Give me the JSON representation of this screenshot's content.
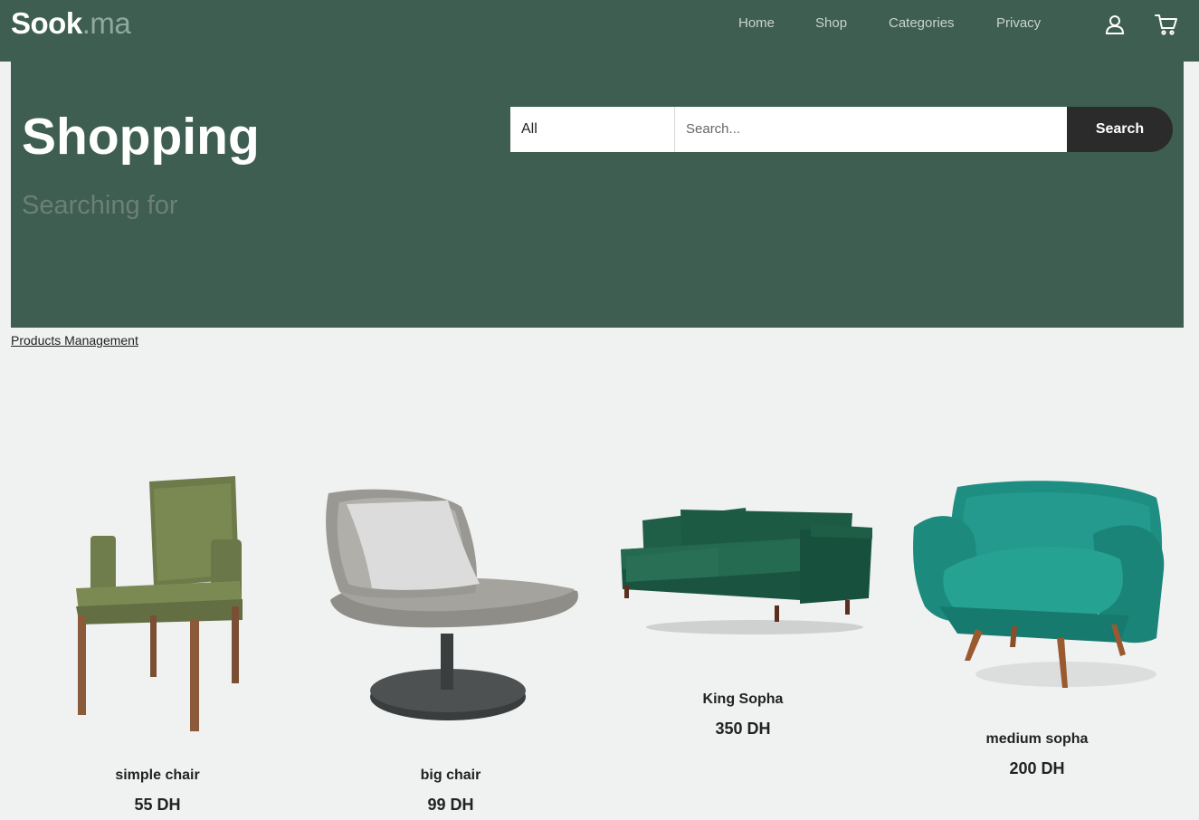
{
  "navbar": {
    "brand_main": "Sook",
    "brand_suffix": ".ma",
    "links": [
      "Home",
      "Shop",
      "Categories",
      "Privacy"
    ],
    "icons": [
      "user-icon",
      "cart-icon"
    ]
  },
  "hero": {
    "title": "Shopping",
    "subtitle": "Searching for"
  },
  "search": {
    "category": "All",
    "placeholder": "Search...",
    "button_label": "Search"
  },
  "management_link": "Products Management",
  "products": [
    {
      "name": "simple chair",
      "price": "55 DH"
    },
    {
      "name": "big chair",
      "price": "99 DH"
    },
    {
      "name": "King Sopha",
      "price": "350 DH"
    },
    {
      "name": "medium sopha",
      "price": "200 DH"
    }
  ],
  "colors": {
    "primary": "#3d5e51",
    "background": "#f0f1f1",
    "button": "#2b2b2b"
  }
}
